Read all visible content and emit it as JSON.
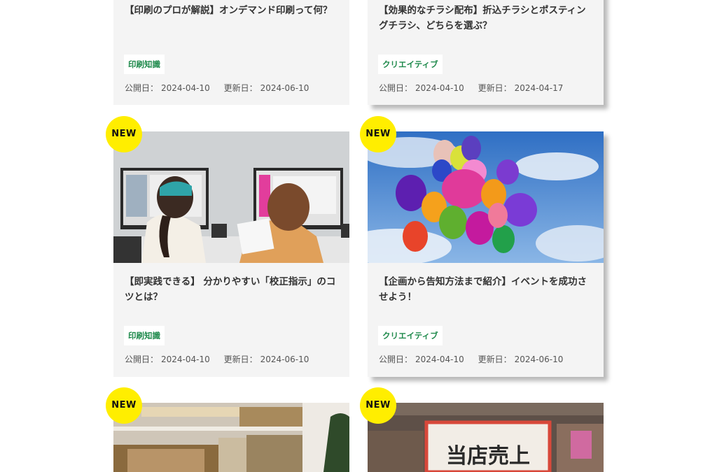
{
  "cards": [
    {
      "title": "【印刷のプロが解説】オンデマンド印刷って何？",
      "tag": "印刷知識",
      "published_label": "公開日：",
      "published": "2024-04-10",
      "updated_label": "更新日：",
      "updated": "2024-06-10"
    },
    {
      "title": "【効果的なチラシ配布】折込チラシとポスティングチラシ、どちらを選ぶ？",
      "tag": "クリエイティブ",
      "published_label": "公開日：",
      "published": "2024-04-10",
      "updated_label": "更新日：",
      "updated": "2024-04-17"
    },
    {
      "badge": "NEW",
      "title": "【即実践できる】 分かりやすい「校正指示」のコツとは？",
      "tag": "印刷知識",
      "published_label": "公開日：",
      "published": "2024-04-10",
      "updated_label": "更新日：",
      "updated": "2024-06-10"
    },
    {
      "badge": "NEW",
      "title": "【企画から告知方法まで紹介】イベントを成功させよう！",
      "tag": "クリエイティブ",
      "published_label": "公開日：",
      "published": "2024-04-10",
      "updated_label": "更新日：",
      "updated": "2024-06-10"
    },
    {
      "badge": "NEW"
    },
    {
      "badge": "NEW",
      "image_text": "当店売上"
    }
  ],
  "colors": {
    "badge": "#ffee00",
    "tag_text": "#1f8a4c",
    "card_bg": "#f4f4f4"
  }
}
